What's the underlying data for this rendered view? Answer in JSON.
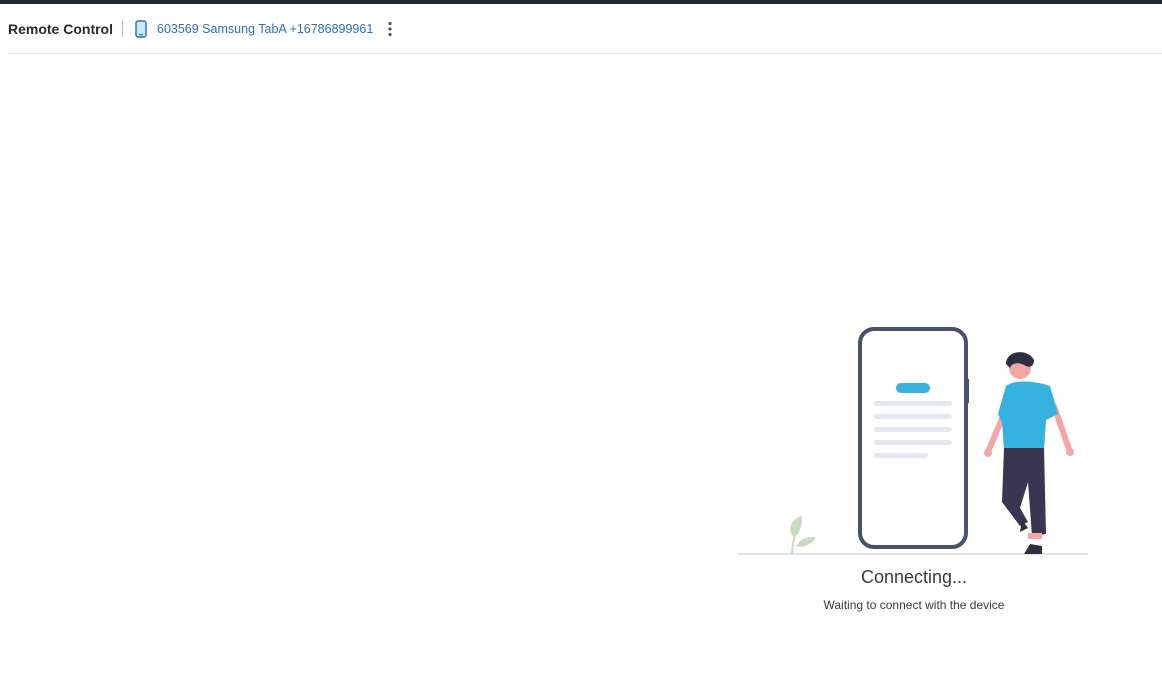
{
  "header": {
    "title": "Remote Control",
    "device_icon": "phone-icon",
    "device_label": "603569 Samsung TabA +16786899961",
    "menu_icon": "kebab-menu-icon"
  },
  "status": {
    "title": "Connecting...",
    "subtitle": "Waiting to connect with the device"
  },
  "colors": {
    "topbar": "#1f2a33",
    "link": "#2f6fb3",
    "accent": "#35b2e0",
    "phone_frame": "#4a4f6a"
  }
}
